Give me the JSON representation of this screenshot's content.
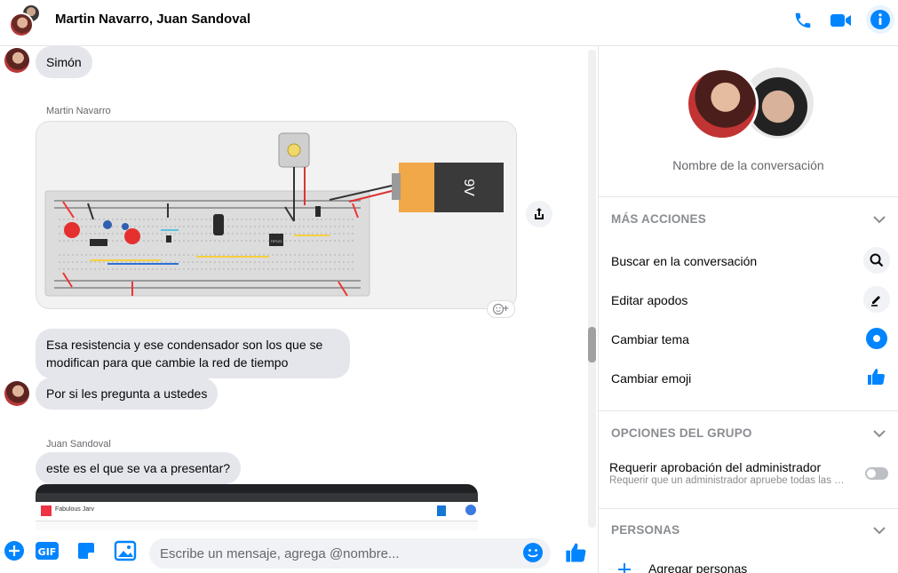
{
  "header": {
    "title": "Martin Navarro, Juan Sandoval"
  },
  "messages": {
    "m1": "Simón",
    "sender1": "Martin Navarro",
    "m2": "Esa resistencia y ese condensador son los que se modifican para que cambie la red de tiempo",
    "m3": "Por si les pregunta a ustedes",
    "sender2": "Juan Sandoval",
    "m4": "este es el que se va a presentar?"
  },
  "circuit_image": {
    "battery_label": "9V",
    "chip_label": "TIP122"
  },
  "screenshot_thumb": {
    "app_name": "Fabulous Jarv"
  },
  "composer": {
    "placeholder": "Escribe un mensaje, agrega @nombre..."
  },
  "sidebar": {
    "conversation_name": "Nombre de la conversación",
    "more_actions_title": "MÁS ACCIONES",
    "actions": [
      {
        "label": "Buscar en la conversación",
        "icon": "search-icon"
      },
      {
        "label": "Editar apodos",
        "icon": "pencil-icon"
      },
      {
        "label": "Cambiar tema",
        "icon": "theme-circle-icon"
      },
      {
        "label": "Cambiar emoji",
        "icon": "thumbs-up-icon"
      }
    ],
    "group_options_title": "OPCIONES DEL GRUPO",
    "require_approval_title": "Requerir aprobación del administrador",
    "require_approval_sub": "Requerir que un administrador apruebe todas las solicitudes",
    "people_title": "PERSONAS",
    "add_people": "Agregar personas"
  },
  "colors": {
    "accent": "#0084ff",
    "bubble": "#e4e6eb"
  }
}
